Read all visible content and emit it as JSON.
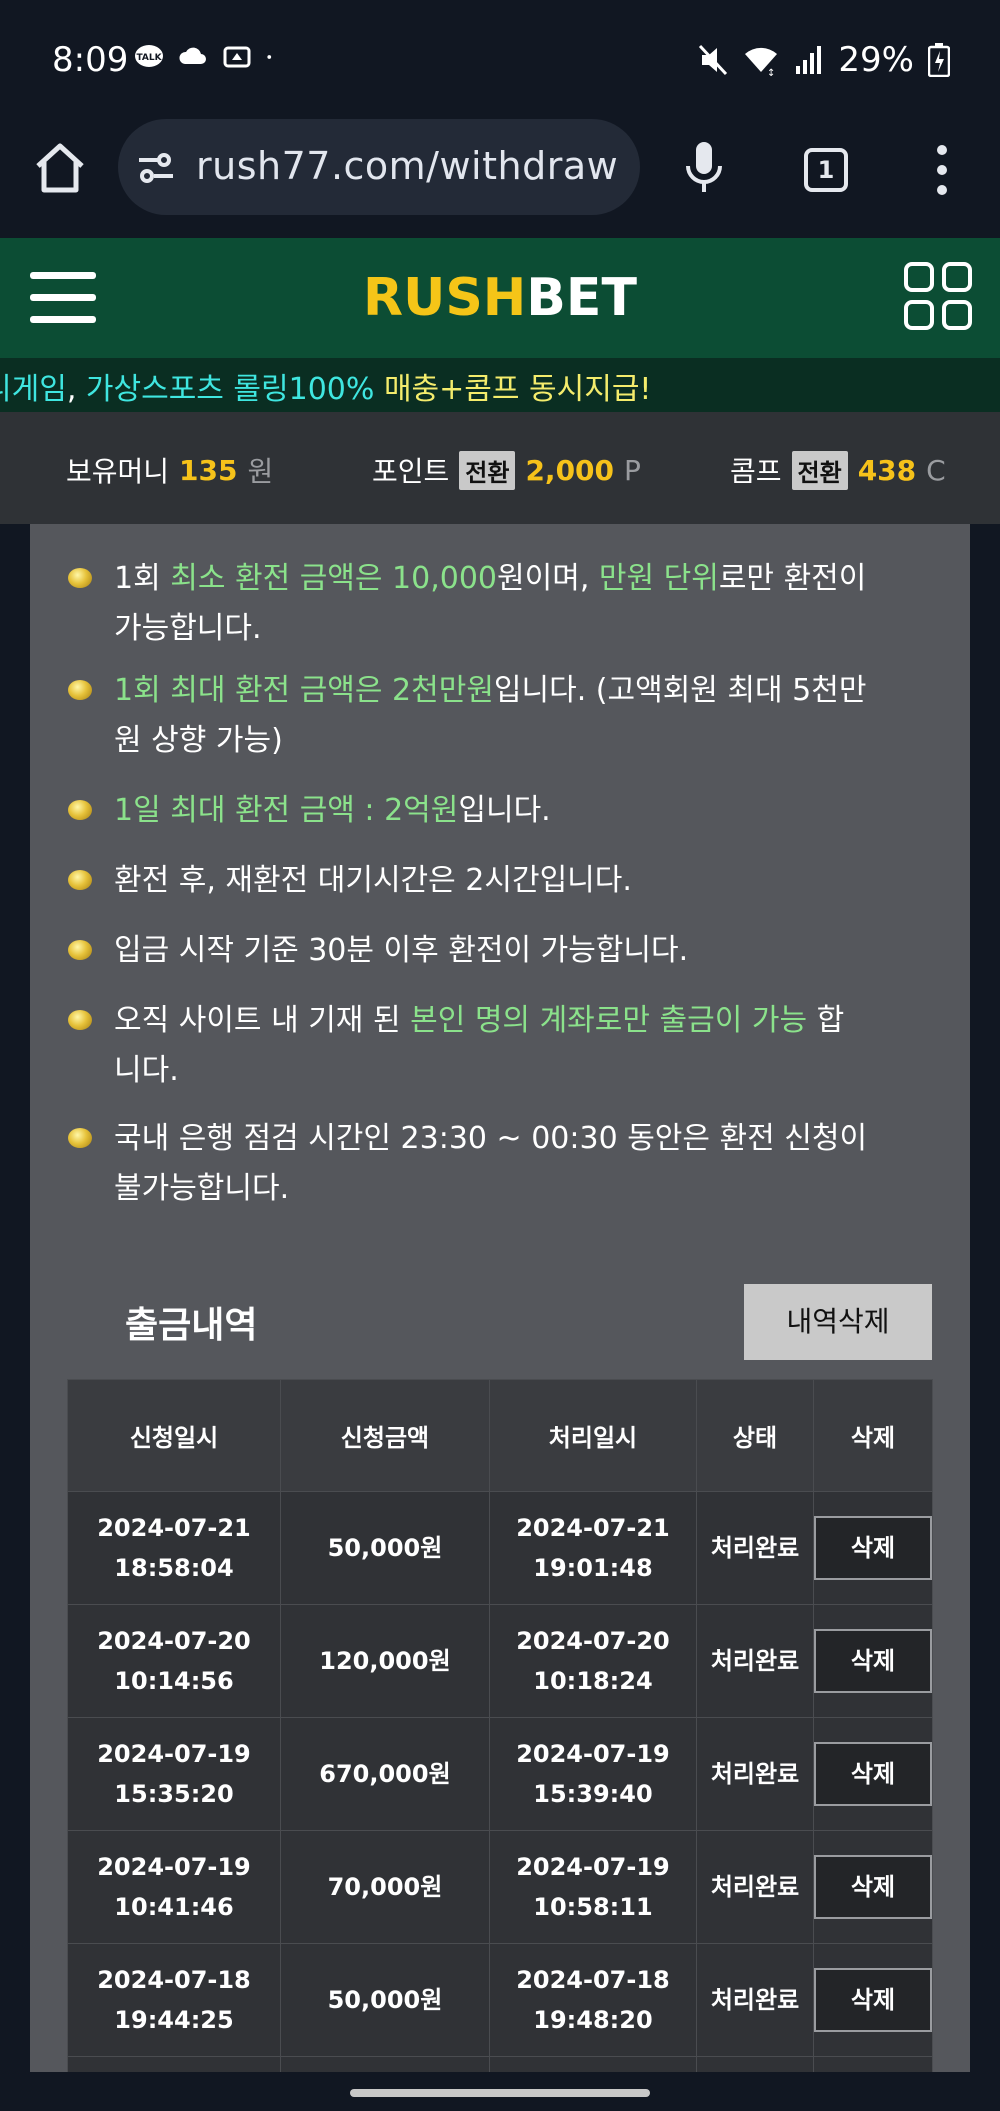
{
  "status_bar": {
    "time": "8:09",
    "battery": "29%",
    "left_icons": [
      "talk-icon",
      "cloud-icon",
      "drive-icon",
      "dot-icon"
    ],
    "right_icons": [
      "mute-icon",
      "wifi-icon",
      "signal-icon",
      "battery-icon"
    ]
  },
  "browser": {
    "url": "rush77.com/withdraw",
    "tab_count": "1"
  },
  "site": {
    "logo_part1": "RUSH",
    "logo_part2": "BET",
    "marquee": {
      "seg1": "니게임",
      "seg2": ", ",
      "seg3": "가상스포츠 롤링100%",
      "seg4": " 매충+콤프 동시지급!"
    }
  },
  "balance": {
    "money_label": "보유머니",
    "money_value": "135",
    "money_unit": "원",
    "point_label": "포인트",
    "point_btn": "전환",
    "point_value": "2,000",
    "point_unit": "P",
    "comp_label": "콤프",
    "comp_btn": "전환",
    "comp_value": "438",
    "comp_unit": "C"
  },
  "notices": [
    {
      "a": "1회 ",
      "b": "최소 환전 금액은 10,000",
      "c": "원이며, ",
      "d": "만원 단위",
      "e": "로만 환전이",
      "f": "가능합니다."
    },
    {
      "a": "1회 최대 환전 금액은 2천만원",
      "b": "입니다. (고액회원 최대 5천만",
      "c": "원 상향 가능)"
    },
    {
      "a": "1일 최대 환전 금액 : 2억원",
      "b": "입니다."
    },
    {
      "a": "환전 후, 재환전 대기시간은 2시간입니다."
    },
    {
      "a": "입금 시작 기준 30분 이후 환전이 가능합니다."
    },
    {
      "a": "오직 사이트 내 기재 된 ",
      "b": "본인 명의 계좌로만 출금이 가능",
      "c": " 합",
      "d": "니다."
    },
    {
      "a": "국내 은행 점검 시간인 23:30 ~ 00:30 동안은 환전 신청이",
      "b": "불가능합니다."
    }
  ],
  "history": {
    "title": "출금내역",
    "delete_all_label": "내역삭제",
    "columns": [
      "신청일시",
      "신청금액",
      "처리일시",
      "상태",
      "삭제"
    ],
    "rows": [
      {
        "req_date": "2024-07-21",
        "req_time": "18:58:04",
        "amount": "50,000원",
        "proc_date": "2024-07-21",
        "proc_time": "19:01:48",
        "status": "처리완료",
        "delete": "삭제"
      },
      {
        "req_date": "2024-07-20",
        "req_time": "10:14:56",
        "amount": "120,000원",
        "proc_date": "2024-07-20",
        "proc_time": "10:18:24",
        "status": "처리완료",
        "delete": "삭제"
      },
      {
        "req_date": "2024-07-19",
        "req_time": "15:35:20",
        "amount": "670,000원",
        "proc_date": "2024-07-19",
        "proc_time": "15:39:40",
        "status": "처리완료",
        "delete": "삭제"
      },
      {
        "req_date": "2024-07-19",
        "req_time": "10:41:46",
        "amount": "70,000원",
        "proc_date": "2024-07-19",
        "proc_time": "10:58:11",
        "status": "처리완료",
        "delete": "삭제"
      },
      {
        "req_date": "2024-07-18",
        "req_time": "19:44:25",
        "amount": "50,000원",
        "proc_date": "2024-07-18",
        "proc_time": "19:48:20",
        "status": "처리완료",
        "delete": "삭제"
      }
    ]
  },
  "colors": {
    "header_green": "#0c4d34",
    "logo_yellow": "#f5c518",
    "highlight_green": "#8be28b",
    "value_yellow": "#f6c21a"
  }
}
